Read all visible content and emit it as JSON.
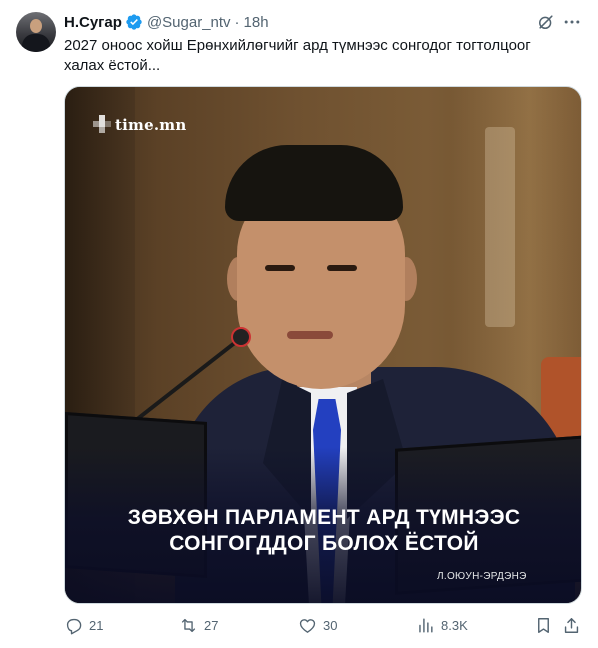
{
  "tweet": {
    "author_name": "Н.Сугар",
    "handle": "@Sugar_ntv",
    "separator": "·",
    "time": "18h",
    "text": "2027 оноос хойш Ерөнхийлөгчийг ард түмнээс сонгодог тогтолцоог халах ёстой...",
    "icons": [
      "verified-badge-icon",
      "grok-icon",
      "more-icon"
    ]
  },
  "media": {
    "logo_text": "time.mn",
    "headline_line1": "ЗӨВХӨН ПАРЛАМЕНТ АРД ТҮМНЭЭС",
    "headline_line2": "СОНГОГДДОГ БОЛОХ ЁСТОЙ",
    "credit": "Л.ОЮУН-ЭРДЭНЭ"
  },
  "actions": {
    "replies": "21",
    "retweets": "27",
    "likes": "30",
    "views": "8.3K",
    "icons": [
      "reply-icon",
      "retweet-icon",
      "like-icon",
      "views-icon",
      "bookmark-icon",
      "share-icon"
    ]
  },
  "colors": {
    "verified": "#1d9bf0",
    "secondary_text": "#536471",
    "primary_text": "#0f1419",
    "border": "#cfd9de"
  }
}
